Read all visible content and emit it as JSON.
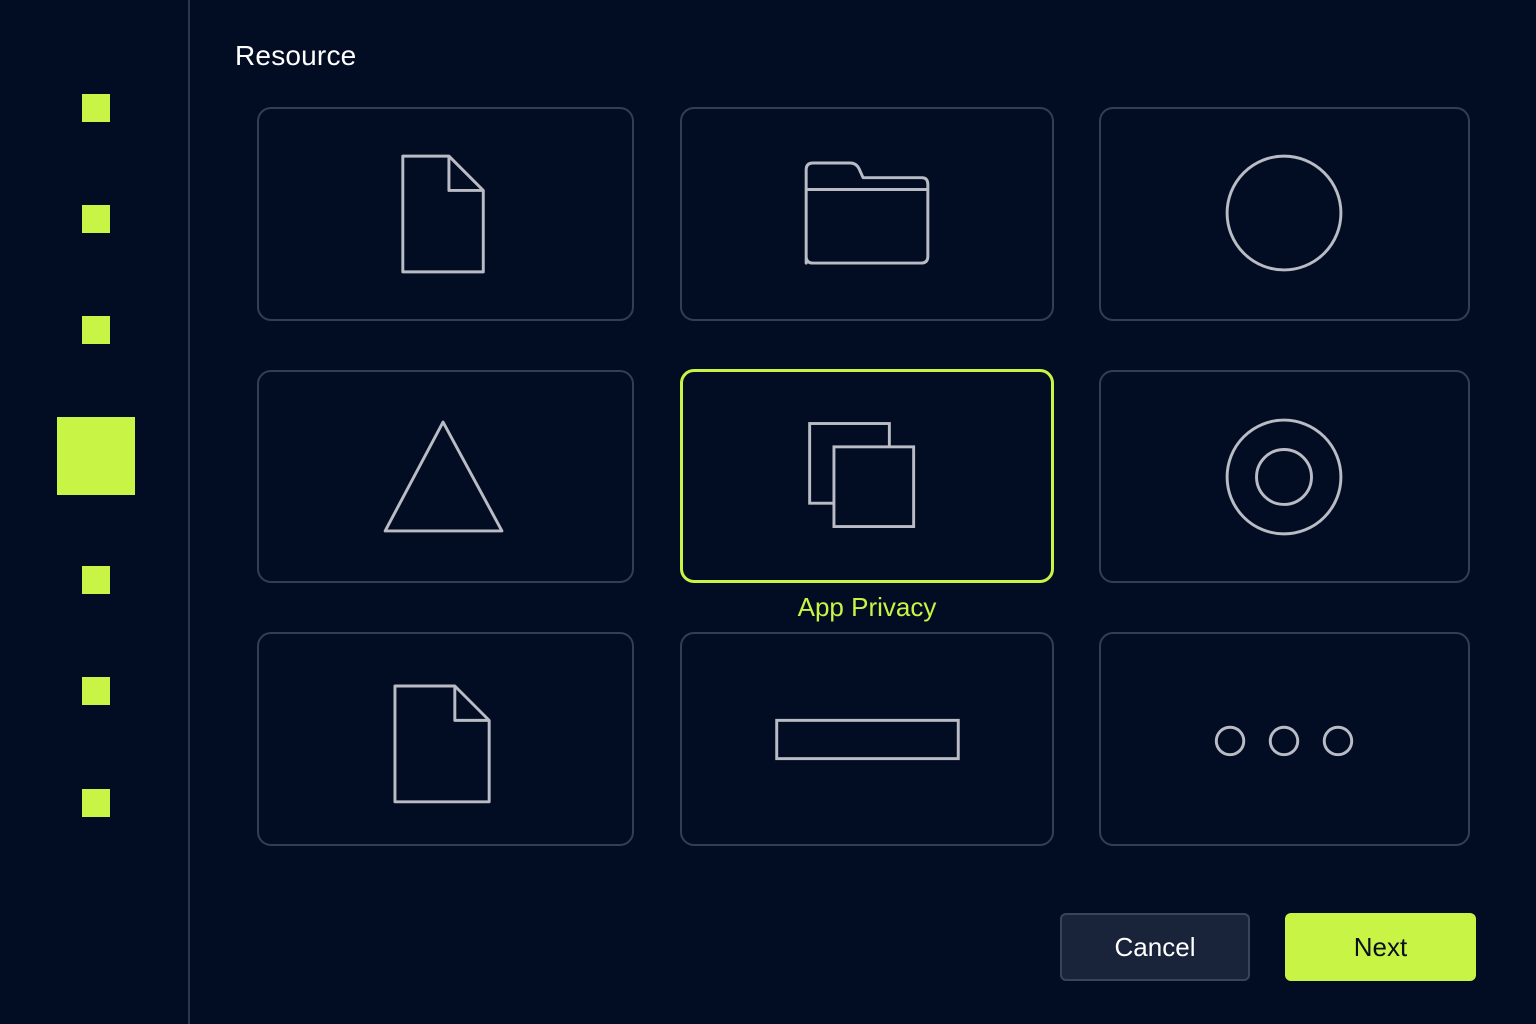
{
  "page": {
    "title": "Resource"
  },
  "colors": {
    "background": "#020d24",
    "accent": "#c8f545",
    "tile_border": "#343d52",
    "icon_stroke": "#b9bcc4"
  },
  "sidebar": {
    "steps": [
      {
        "icon": "step-marker",
        "current": false
      },
      {
        "icon": "step-marker",
        "current": false
      },
      {
        "icon": "step-marker",
        "current": false
      },
      {
        "icon": "step-marker",
        "current": true
      },
      {
        "icon": "step-marker",
        "current": false
      },
      {
        "icon": "step-marker",
        "current": false
      },
      {
        "icon": "step-marker",
        "current": false
      }
    ]
  },
  "grid": {
    "tiles": [
      {
        "icon": "document-icon",
        "selected": false
      },
      {
        "icon": "folder-icon",
        "selected": false
      },
      {
        "icon": "circle-icon",
        "selected": false
      },
      {
        "icon": "triangle-icon",
        "selected": false
      },
      {
        "icon": "copy-icon",
        "selected": true,
        "label": "App Privacy"
      },
      {
        "icon": "ring-icon",
        "selected": false
      },
      {
        "icon": "document-icon",
        "selected": false
      },
      {
        "icon": "rectangle-icon",
        "selected": false
      },
      {
        "icon": "more-icon",
        "selected": false
      }
    ]
  },
  "footer": {
    "cancel_label": "Cancel",
    "next_label": "Next"
  }
}
